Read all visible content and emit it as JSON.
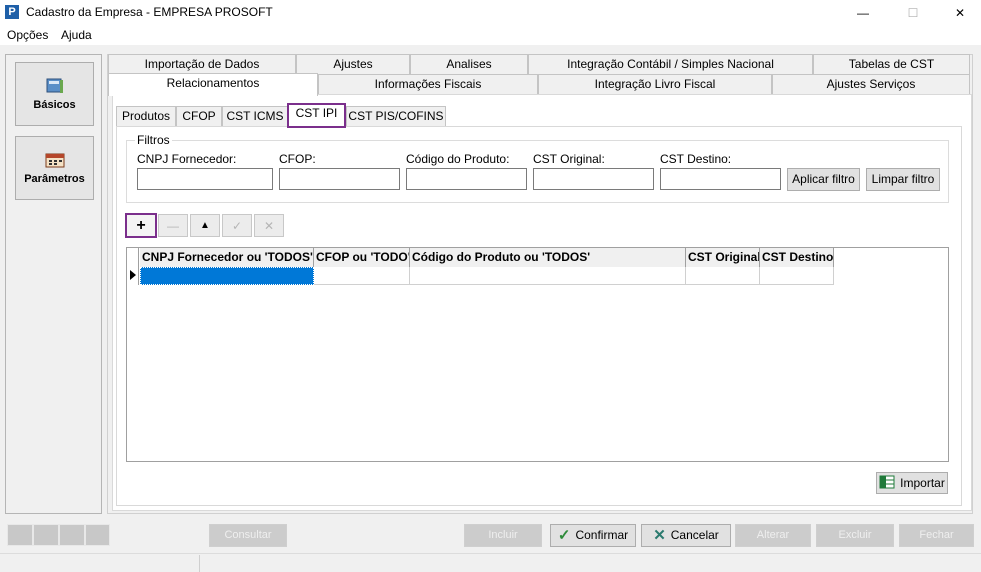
{
  "window": {
    "title": "Cadastro da Empresa - EMPRESA PROSOFT",
    "icon_letter": "P",
    "minimize_symbol": "—",
    "maximize_symbol": "☐",
    "close_symbol": "✕"
  },
  "menu": [
    "Opções",
    "Ajuda"
  ],
  "sidebar": {
    "items": [
      {
        "label": "Básicos",
        "icon": "book-icon"
      },
      {
        "label": "Parâmetros",
        "icon": "calendar-icon"
      }
    ]
  },
  "top_tabs": {
    "row1": [
      "Importação de Dados",
      "Ajustes",
      "Analises",
      "Integração Contábil / Simples Nacional",
      "Tabelas de CST"
    ],
    "row2": [
      "Relacionamentos",
      "Informações Fiscais",
      "Integração Livro Fiscal",
      "Ajustes Serviços"
    ],
    "active": "Relacionamentos"
  },
  "sub_tabs": {
    "items": [
      "Produtos",
      "CFOP",
      "CST ICMS",
      "CST IPI",
      "CST PIS/COFINS"
    ],
    "active": "CST IPI"
  },
  "filters": {
    "legend": "Filtros",
    "labels": [
      "CNPJ Fornecedor:",
      "CFOP:",
      "Código do Produto:",
      "CST Original:",
      "CST Destino:"
    ],
    "values": [
      "",
      "",
      "",
      "",
      ""
    ],
    "apply_label": "Aplicar filtro",
    "clear_label": "Limpar filtro"
  },
  "navigator": {
    "add": "+",
    "delete": "—",
    "edit": "▲",
    "post": "✓",
    "cancel": "✕"
  },
  "grid": {
    "columns": [
      "CNPJ Fornecedor ou 'TODOS'",
      "CFOP ou 'TODO'",
      "Código do Produto ou 'TODOS'",
      "CST Original",
      "CST Destino"
    ],
    "rows": [
      [
        "",
        "",
        "",
        "",
        ""
      ]
    ]
  },
  "import_label": "Importar",
  "bottom_bar": {
    "consultar": "Consultar",
    "incluir": "Incluir",
    "confirmar": "Confirmar",
    "cancelar": "Cancelar",
    "alterar": "Alterar",
    "excluir": "Excluir",
    "fechar": "Fechar"
  },
  "colors": {
    "highlight": "#7b2f8c",
    "selected_cell": "#0078d7",
    "confirm_check": "#2e8b3a",
    "cancel_x": "#2a7a6e"
  }
}
